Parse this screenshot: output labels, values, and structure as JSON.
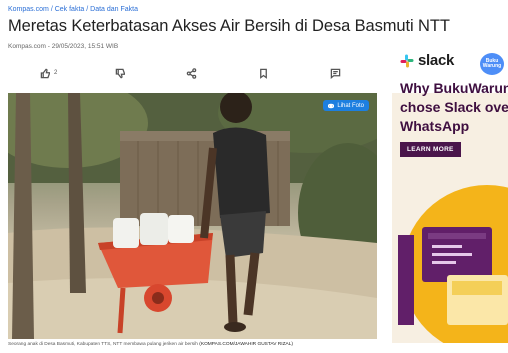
{
  "breadcrumb": [
    "Kompas.com",
    "Cek fakta",
    "Data dan Fakta"
  ],
  "breadcrumb_separator": "/",
  "article": {
    "title": "Meretas Keterbatasan Akses Air Bersih di Desa Basmuti NTT",
    "meta": "Kompas.com - 29/05/2023, 15:51 WIB"
  },
  "actions": {
    "like_count": "2",
    "icons": [
      "thumbs-up-icon",
      "thumbs-down-icon",
      "share-icon",
      "bookmark-icon",
      "comment-icon"
    ]
  },
  "photo": {
    "view_button": "Lihat Foto",
    "caption": "Seorang anak di Desa Basmuti, Kabupaten TTS, NTT membawa pulang jeriken air bersih",
    "credit": "(KOMPAS.COM/JAWAHIR GUSTAV RIZAL)"
  },
  "ad": {
    "brand": "slack",
    "badge": "Buku Warung",
    "headline_lines": [
      "Why BukuWarung",
      "chose Slack over",
      "WhatsApp"
    ],
    "cta": "LEARN MORE",
    "colors": {
      "cta_bg": "#4a154b",
      "headline": "#3f0f40",
      "art_yellow": "#f4b41a",
      "art_purple": "#611f69"
    }
  },
  "colors": {
    "link": "#2b6fd6",
    "photo_button": "#1d7fe0"
  }
}
